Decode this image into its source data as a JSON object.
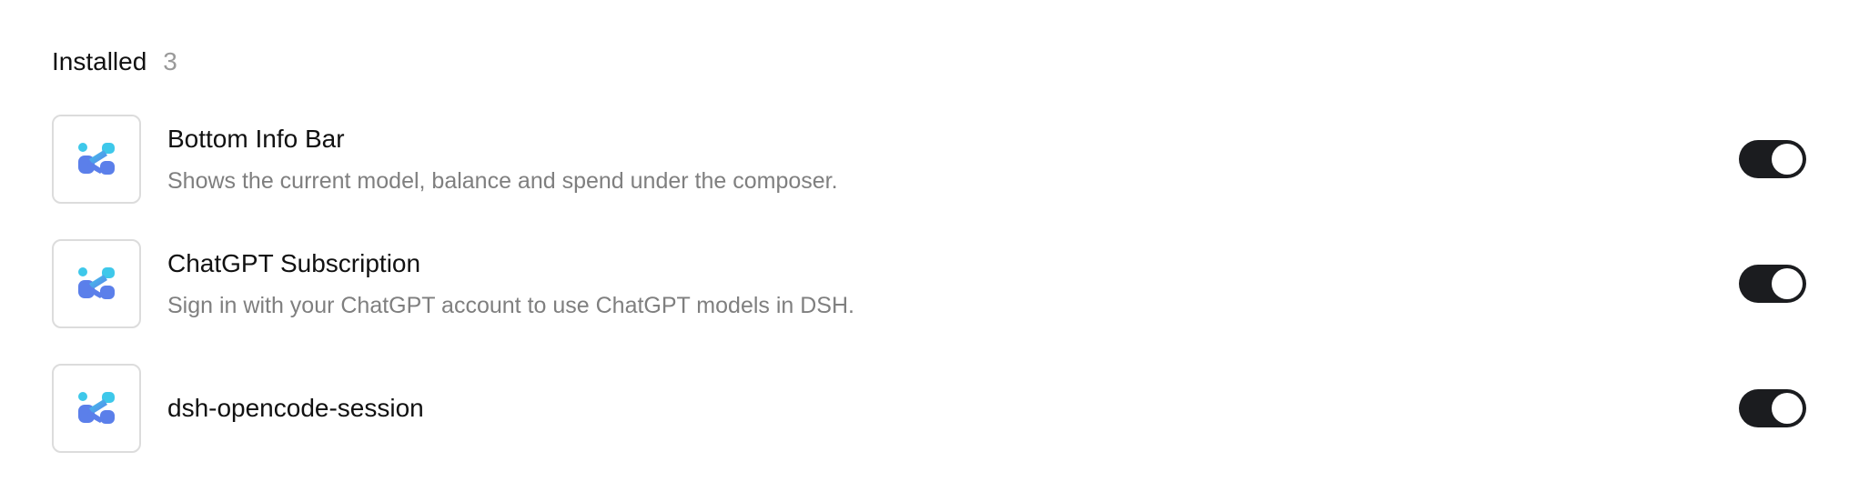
{
  "section": {
    "title": "Installed",
    "count": "3"
  },
  "plugins": [
    {
      "name": "Bottom Info Bar",
      "description": "Shows the current model, balance and spend under the composer.",
      "enabled": true,
      "icon": "dsh-logo-icon"
    },
    {
      "name": "ChatGPT Subscription",
      "description": "Sign in with your ChatGPT account to use ChatGPT models in DSH.",
      "enabled": true,
      "icon": "dsh-logo-icon"
    },
    {
      "name": "dsh-opencode-session",
      "description": "",
      "enabled": true,
      "icon": "dsh-logo-icon"
    }
  ],
  "colors": {
    "toggle_on": "#1b1c1f",
    "icon_cyan": "#3ec8ea",
    "icon_blue": "#5b7fea"
  }
}
